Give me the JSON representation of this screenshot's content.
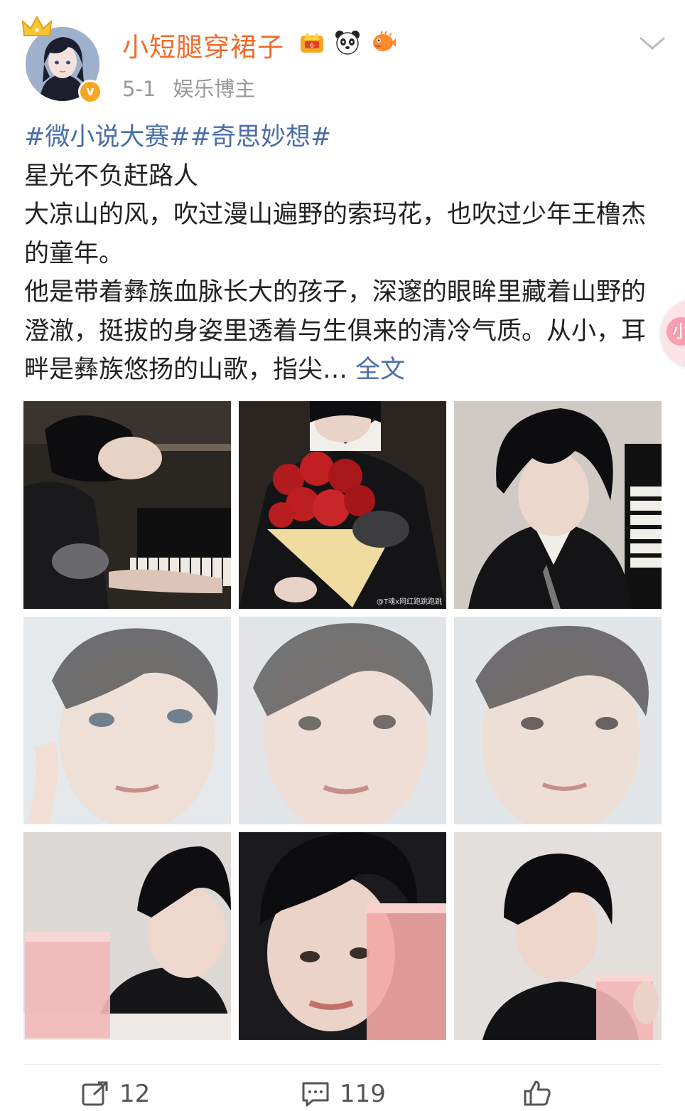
{
  "header": {
    "username": "小短腿穿裙子",
    "date": "5-1",
    "category": "娱乐博主",
    "badges": [
      "vip-crown-badge",
      "panda-badge",
      "pufferfish-badge"
    ],
    "verified_mark": "v"
  },
  "post": {
    "hashtags": "#微小说大赛##奇思妙想#",
    "lines": [
      "星光不负赶路人",
      "大凉山的风，吹过漫山遍野的索玛花，也吹过少年王橹杰的童年。",
      "他是带着彝族血脉长大的孩子，深邃的眼眸里藏着山野的澄澈，挺拔的身姿里透着与生俱来的清冷气质。从小，耳畔是彝族悠扬的山歌，指尖…"
    ],
    "more_label": "全文"
  },
  "images": {
    "watermark": "@T魂x网红跑跳跑跳",
    "items": [
      "photo-piano-lean",
      "photo-red-roses",
      "photo-piano-portrait",
      "photo-glass-blur-1",
      "photo-glass-blur-2",
      "photo-glass-blur-3",
      "photo-pink-drink-1",
      "photo-pink-drink-2",
      "photo-pink-drink-3"
    ]
  },
  "actions": {
    "repost_count": "12",
    "comment_count": "119",
    "like_count": ""
  },
  "side_bubble": {
    "label": "小"
  },
  "colors": {
    "username": "#f26b2a",
    "link": "#4a6ea8",
    "meta": "#999999",
    "text": "#222222"
  }
}
